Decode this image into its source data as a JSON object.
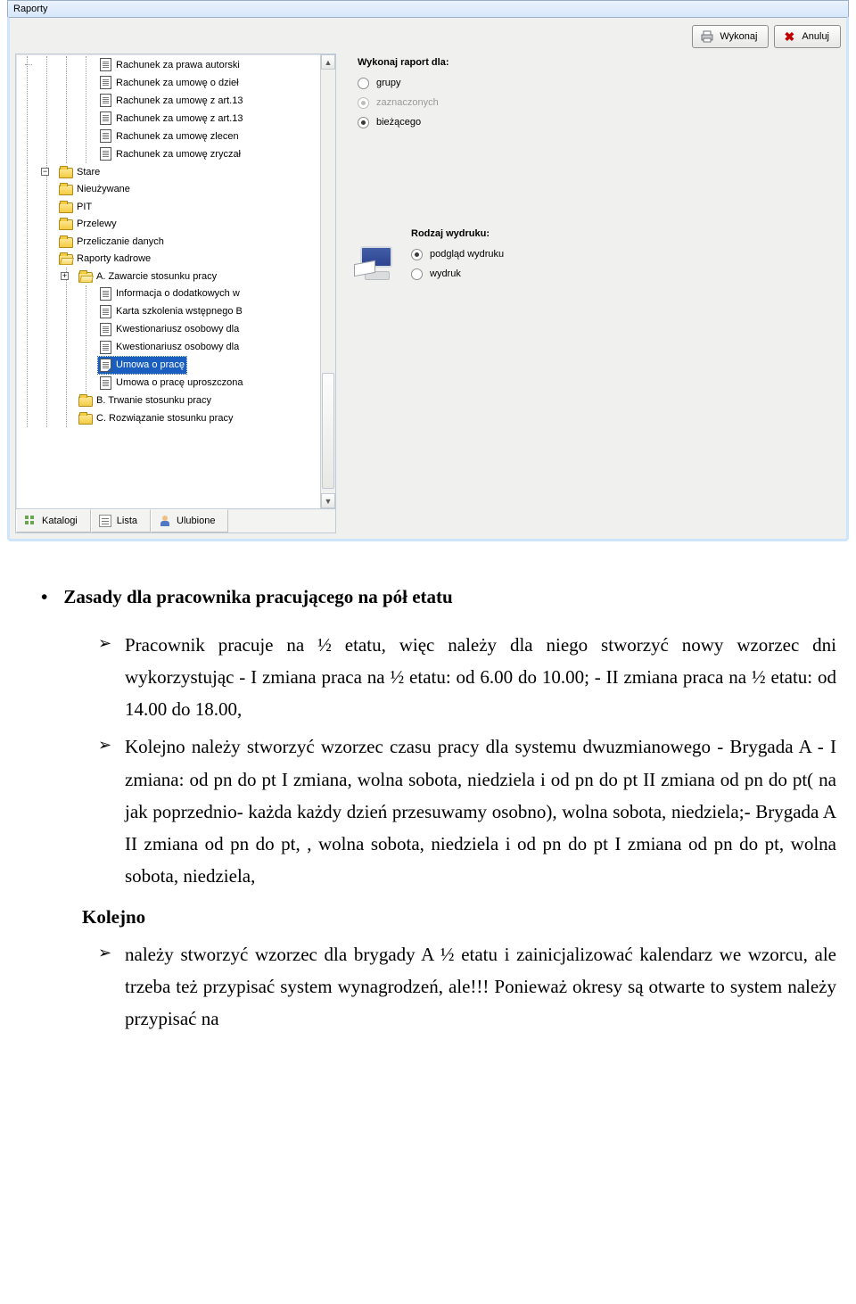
{
  "window": {
    "title": "Raporty"
  },
  "toolbar": {
    "execute_label": "Wykonaj",
    "cancel_label": "Anuluj"
  },
  "tree": {
    "docs_top": [
      "Rachunek za prawa autorski",
      "Rachunek za umowę o dzieł",
      "Rachunek za umowę z art.13",
      "Rachunek za umowę z art.13",
      "Rachunek za umowę zlecen",
      "Rachunek za umowę zryczał"
    ],
    "folders_mid": [
      {
        "label": "Stare",
        "exp": "+"
      },
      {
        "label": "Nieużywane",
        "exp": "+"
      },
      {
        "label": "PIT",
        "exp": "+"
      },
      {
        "label": "Przelewy",
        "exp": ""
      },
      {
        "label": "Przeliczanie danych",
        "exp": "+"
      },
      {
        "label": "Raporty kadrowe",
        "exp": "−"
      }
    ],
    "a_label": "A. Zawarcie stosunku pracy",
    "a_docs": [
      "Informacja o dodatkowych w",
      "Karta szkolenia wstępnego B",
      "Kwestionariusz osobowy dla",
      "Kwestionariusz osobowy dla",
      "Umowa o pracę",
      "Umowa o pracę uproszczona"
    ],
    "selected_index": 4,
    "b_label": "B. Trwanie stosunku pracy",
    "c_label": "C. Rozwiązanie stosunku pracy"
  },
  "tabs": {
    "catalogs": "Katalogi",
    "list": "Lista",
    "favorites": "Ulubione"
  },
  "right": {
    "group_title": "Wykonaj raport dla:",
    "options": [
      {
        "label": "grupy",
        "state": "unselected"
      },
      {
        "label": "zaznaczonych",
        "state": "disabled"
      },
      {
        "label": "bieżącego",
        "state": "selected"
      }
    ],
    "print_title": "Rodzaj wydruku:",
    "print_options": [
      {
        "label": "podgląd wydruku",
        "state": "selected"
      },
      {
        "label": "wydruk",
        "state": "unselected"
      }
    ]
  },
  "doc": {
    "heading": "Zasady dla pracownika pracującego na pół etatu",
    "p1": "Pracownik pracuje na ½ etatu, więc należy dla niego stworzyć nowy wzorzec dni wykorzystując - I zmiana praca na ½ etatu: od 6.00 do 10.00; - II zmiana praca na ½ etatu: od 14.00 do 18.00,",
    "p2": "Kolejno należy stworzyć wzorzec czasu pracy dla systemu dwuzmianowego - Brygada A - I zmiana: od pn do pt I zmiana, wolna sobota, niedziela i od pn do pt II zmiana od pn do pt( na jak poprzednio- każda każdy dzień przesuwamy osobno), wolna sobota, niedziela;- Brygada A II zmiana od pn do pt, , wolna sobota, niedziela i od pn do pt I zmiana od pn do pt, wolna sobota, niedziela,",
    "section": "Kolejno",
    "p3": "należy stworzyć wzorzec dla brygady A ½ etatu i zainicjalizować kalendarz we wzorcu, ale trzeba też przypisać system wynagrodzeń, ale!!! Ponieważ okresy są otwarte to system należy przypisać na"
  }
}
